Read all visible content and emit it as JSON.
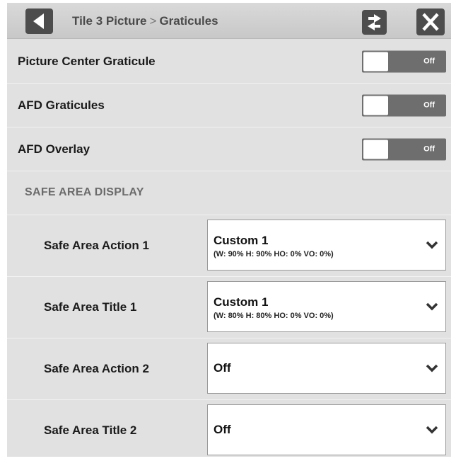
{
  "header": {
    "breadcrumb_parent": "Tile 3 Picture",
    "breadcrumb_separator": ">",
    "breadcrumb_current": "Graticules"
  },
  "toggles": [
    {
      "label": "Picture Center Graticule",
      "state": "Off"
    },
    {
      "label": "AFD Graticules",
      "state": "Off"
    },
    {
      "label": "AFD Overlay",
      "state": "Off"
    }
  ],
  "safe_area": {
    "section_title": "SAFE AREA DISPLAY",
    "items": [
      {
        "label": "Safe Area Action 1",
        "value": "Custom 1",
        "detail": "(W: 90% H: 90% HO: 0% VO: 0%)"
      },
      {
        "label": "Safe Area Title 1",
        "value": "Custom 1",
        "detail": "(W: 80% H: 80% HO: 0% VO: 0%)"
      },
      {
        "label": "Safe Area Action 2",
        "value": "Off",
        "detail": ""
      },
      {
        "label": "Safe Area Title 2",
        "value": "Off",
        "detail": ""
      }
    ]
  },
  "icons": {
    "back": "back-arrow-icon",
    "swap": "swap-arrows-icon",
    "close": "close-x-icon",
    "dropdown": "chevron-down-icon"
  },
  "colors": {
    "panel_bg": "#e1e1e1",
    "button_bg": "#4d4d4d",
    "toggle_off_bg": "#6e6e6e",
    "knob": "#ffffff"
  }
}
